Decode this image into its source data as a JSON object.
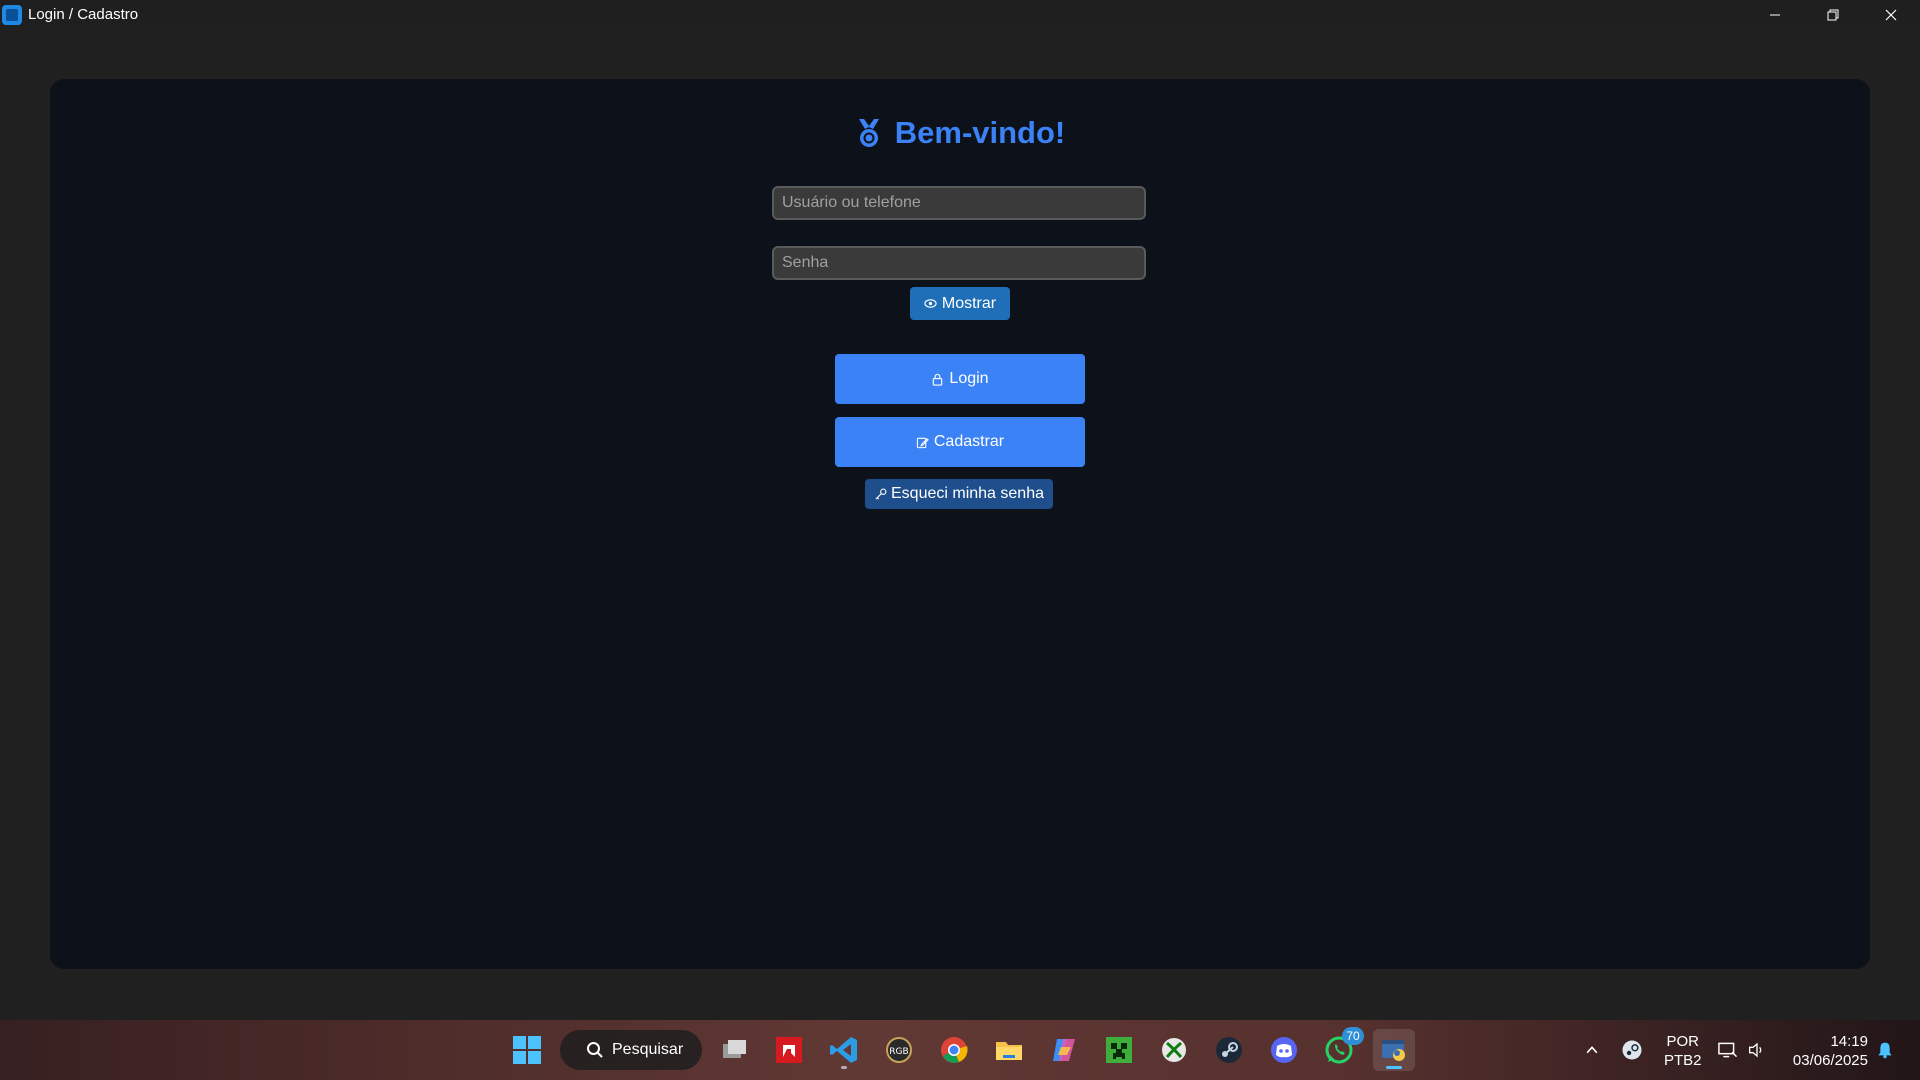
{
  "window": {
    "title": "Login / Cadastro"
  },
  "form": {
    "welcome_title": "Bem-vindo!",
    "user_placeholder": "Usuário ou telefone",
    "user_value": "",
    "password_placeholder": "Senha",
    "password_value": "",
    "show_label": "Mostrar",
    "login_label": "Login",
    "register_label": "Cadastrar",
    "forgot_label": "Esqueci minha senha"
  },
  "taskbar": {
    "search_label": "Pesquisar",
    "whatsapp_badge": "70",
    "language_line1": "POR",
    "language_line2": "PTB2",
    "time": "14:19",
    "date": "03/06/2025"
  },
  "colors": {
    "accent": "#3b82f6",
    "frame_bg": "#0d111a",
    "window_bg": "#202020"
  },
  "icons": [
    "medal-icon",
    "eye-icon",
    "lock-icon",
    "edit-icon",
    "key-icon"
  ]
}
